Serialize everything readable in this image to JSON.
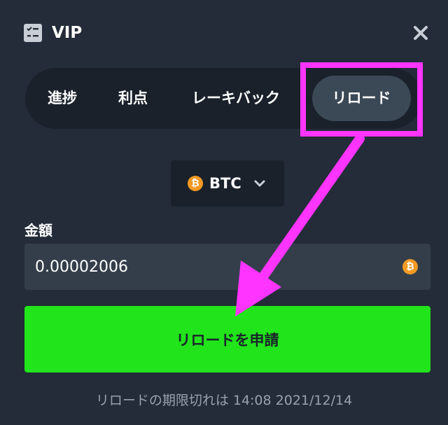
{
  "header": {
    "title": "VIP"
  },
  "tabs": [
    {
      "label": "進捗"
    },
    {
      "label": "利点"
    },
    {
      "label": "レーキバック"
    },
    {
      "label": "リロード"
    }
  ],
  "currency": {
    "selected": "BTC",
    "coin_symbol": "₿"
  },
  "amount": {
    "label": "金額",
    "value": "0.00002006"
  },
  "submit": {
    "label": "リロードを申請"
  },
  "footer": {
    "expiry_text": "リロードの期限切れは 14:08 2021/12/14"
  },
  "colors": {
    "background": "#232c38",
    "tab_bar": "#1a212b",
    "tab_active": "#3b4856",
    "input": "#343e4b",
    "accent_green": "#21e41b",
    "bitcoin_orange": "#f39a22",
    "annotation_magenta": "#ff34ff"
  },
  "icons": {
    "vip": "checklist-icon",
    "close": "close-icon",
    "coin": "bitcoin-icon",
    "dropdown": "chevron-down-icon"
  }
}
